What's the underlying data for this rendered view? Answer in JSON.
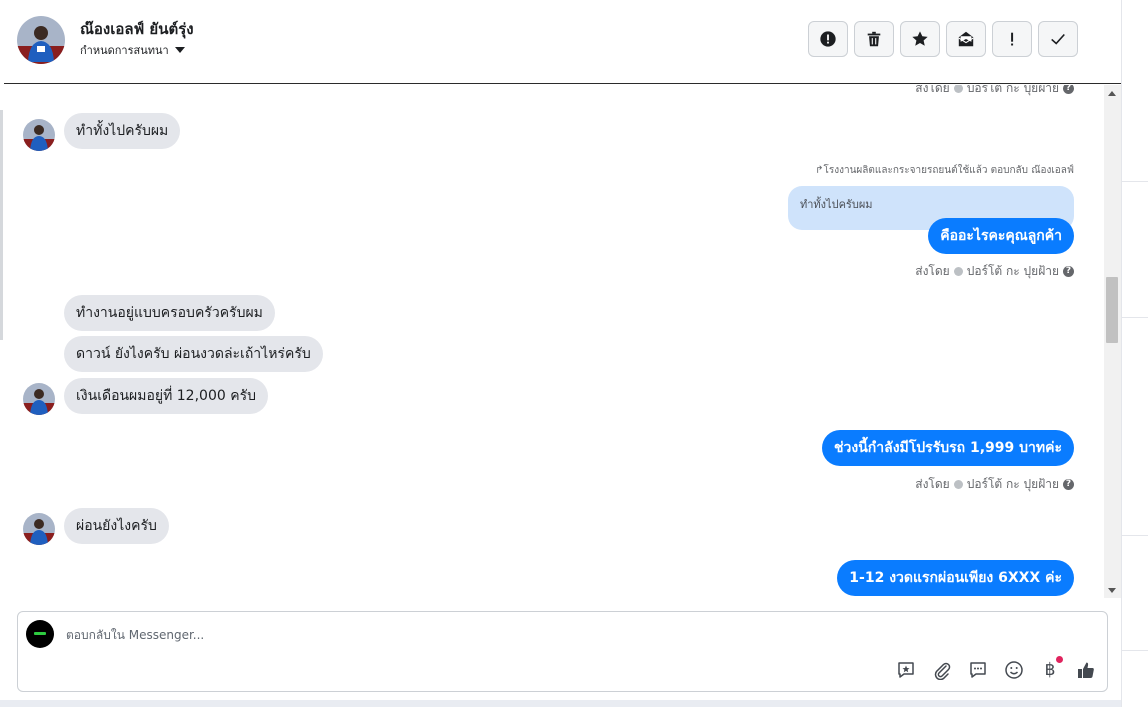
{
  "header": {
    "contact_name": "ณ๊องเอลฟ์ ยันต์รุ่ง",
    "assign_label": "กำหนดการสนทนา",
    "actions": [
      {
        "name": "spam-button",
        "icon": "alert-circle-icon"
      },
      {
        "name": "delete-button",
        "icon": "trash-icon"
      },
      {
        "name": "star-button",
        "icon": "star-icon"
      },
      {
        "name": "mark-unread-button",
        "icon": "envelope-icon"
      },
      {
        "name": "follow-up-button",
        "icon": "exclamation-icon"
      },
      {
        "name": "mark-done-button",
        "icon": "check-icon"
      }
    ]
  },
  "conversation": {
    "top_sent_by": {
      "prefix": "ส่งโดย",
      "agent": "ปอร์โต้ กะ ปุยฝ้าย"
    },
    "msg1": "ทำทั้งไปครับผม",
    "reply_note": "โรงงานผลิตและกระจายรถยนต์ใช้แล้ว ตอบกลับ ณ๊องเอลฟ์",
    "quoted_text": "ทำทั้งไปครับผม",
    "out1": "คืออะไรคะคุณลูกค้า",
    "sent_by_1": {
      "prefix": "ส่งโดย",
      "agent": "ปอร์โต้ กะ ปุยฝ้าย"
    },
    "msg2": "ทำงานอยู่แบบครอบครัวครับผม",
    "msg3": "ดาวน์ ยังไงครับ ผ่อนงวดล่ะเถ้าไหร่ครับ",
    "msg4": "เงินเดือนผมอยู่ที่ 12,000 ครับ",
    "out2": "ช่วงนี้กำลังมีโปรรับรถ 1,999 บาทค่ะ",
    "sent_by_2": {
      "prefix": "ส่งโดย",
      "agent": "ปอร์โต้ กะ ปุยฝ้าย"
    },
    "msg5": "ผ่อนยังไงครับ",
    "out3": "1-12 งวดแรกผ่อนเพียง 6XXX ค่ะ"
  },
  "composer": {
    "placeholder": "ตอบกลับใน Messenger...",
    "tools": [
      "saved-reply-icon",
      "attachment-icon",
      "chat-bubble-icon",
      "emoji-icon",
      "baht-payment-icon",
      "like-thumb-icon"
    ],
    "baht_symbol": "฿"
  },
  "colors": {
    "outgoing_bubble": "#0a7cff",
    "incoming_bubble": "#e4e6eb",
    "quoted_bubble": "#cfe3fb",
    "notification_dot": "#e0245e"
  }
}
